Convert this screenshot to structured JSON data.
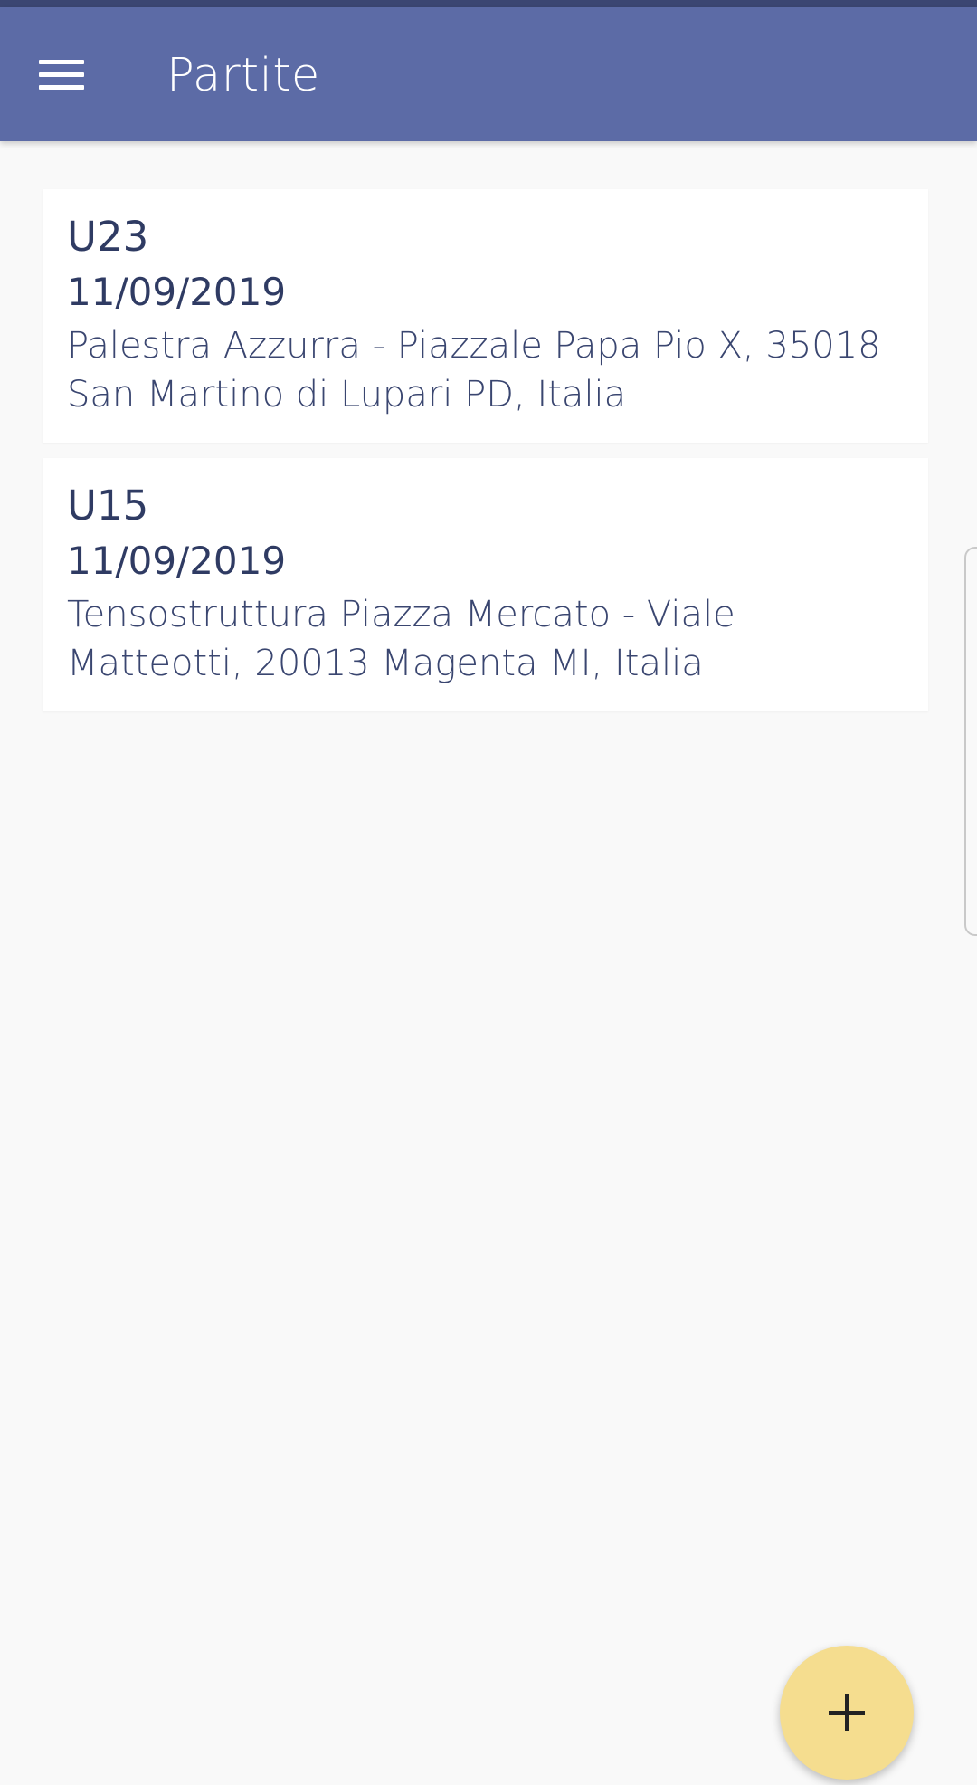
{
  "app_bar": {
    "title": "Partite",
    "menu_icon": "hamburger-menu-icon"
  },
  "matches": [
    {
      "team": "U23",
      "date": "11/09/2019",
      "venue": "Palestra Azzurra - Piazzale Papa Pio X, 35018 San Martino di Lupari PD, Italia"
    },
    {
      "team": "U15",
      "date": "11/09/2019",
      "venue": "Tensostruttura Piazza Mercato - Viale Matteotti, 20013 Magenta MI, Italia"
    }
  ],
  "fab": {
    "icon": "plus-icon"
  },
  "colors": {
    "app_bar": "#5c6ba6",
    "status_strip": "#3b4672",
    "background": "#f9f9f9",
    "text": "#2f3b63",
    "fab": "#f5dd8f"
  }
}
